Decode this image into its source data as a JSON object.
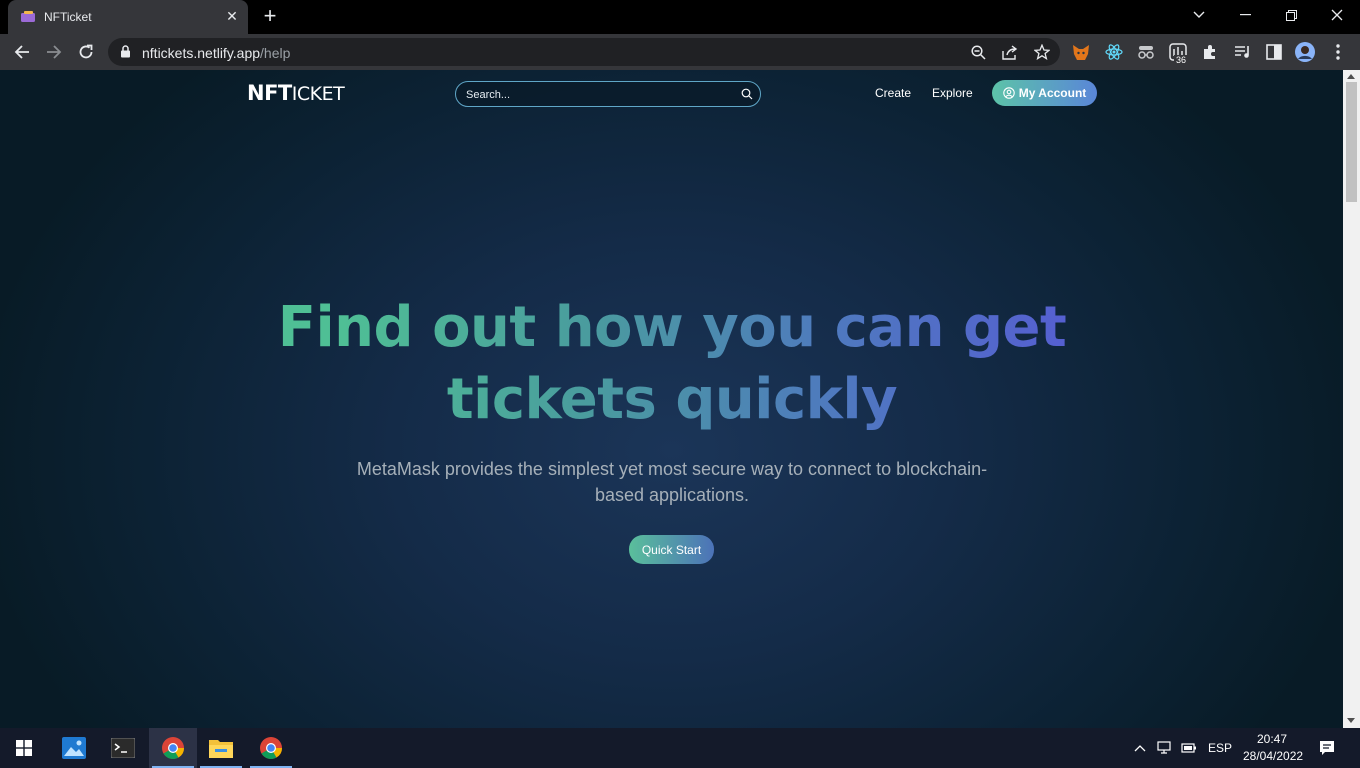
{
  "browser": {
    "tab_title": "NFTicket",
    "new_tab_symbol": "+",
    "close_symbol": "✕",
    "url_host": "nftickets.netlify.app",
    "url_path": "/help",
    "extension_badge": "36"
  },
  "site": {
    "logo_bold": "NFT",
    "logo_rest": "ICKET",
    "search_placeholder": "Search...",
    "nav": {
      "create": "Create",
      "explore": "Explore",
      "account": "My Account"
    },
    "hero": {
      "title_line1": "Find out how you can get",
      "title_line2": "tickets quickly",
      "subtitle_line1": "MetaMask provides the simplest yet most secure way to connect to blockchain-",
      "subtitle_line2": "based applications.",
      "cta": "Quick Start"
    },
    "colors": {
      "accent_green": "#5cc3a8",
      "accent_blue": "#5a86d8"
    }
  },
  "taskbar": {
    "language": "ESP",
    "time": "20:47",
    "date": "28/04/2022"
  }
}
